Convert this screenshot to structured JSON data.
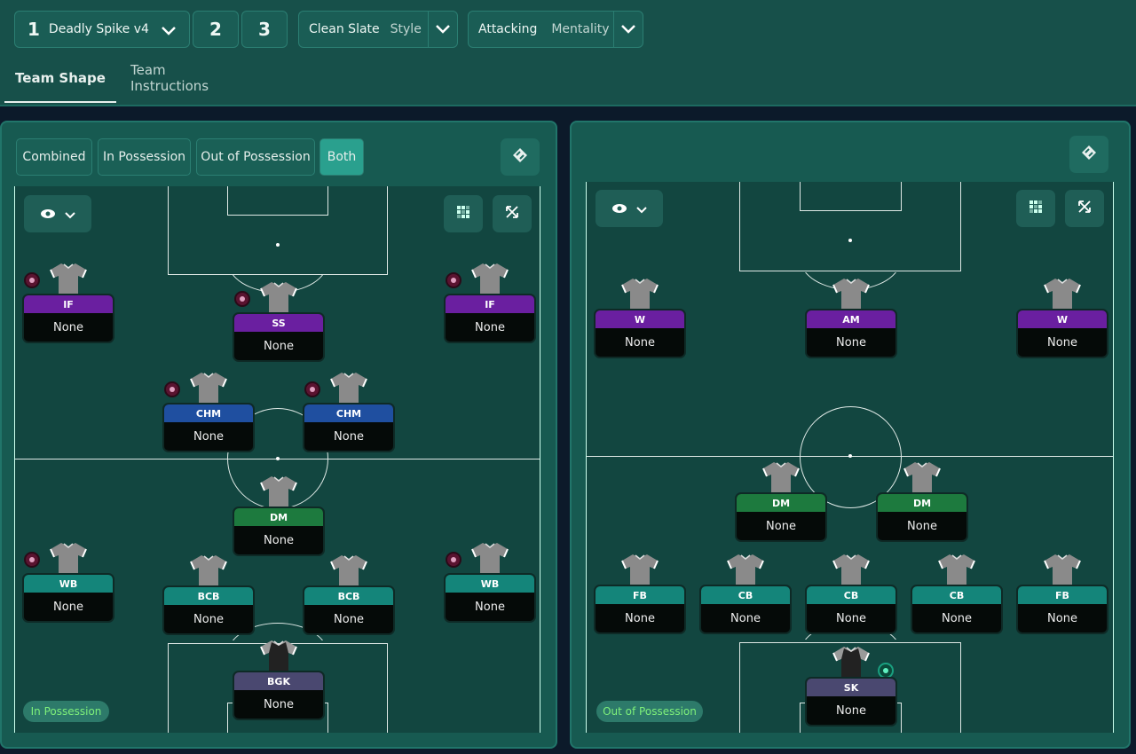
{
  "topbar": {
    "tactic_slot_active": "1",
    "tactic_name": "Deadly Spike v4",
    "tactic_slot_2": "2",
    "tactic_slot_3": "3",
    "style_value": "Clean Slate",
    "style_label": "Style",
    "mentality_value": "Attacking",
    "mentality_label": "Mentality"
  },
  "tabs": {
    "team_shape": "Team Shape",
    "team_instructions": "Team Instructions"
  },
  "left_panel": {
    "segments": [
      "Combined",
      "In Possession",
      "Out of Possession",
      "Both"
    ],
    "active_segment": "Both",
    "phase_pill": "In Possession",
    "players": [
      {
        "role": "IF",
        "name": "None",
        "color": "#6a1fa0"
      },
      {
        "role": "SS",
        "name": "None",
        "color": "#6a1fa0"
      },
      {
        "role": "IF",
        "name": "None",
        "color": "#6a1fa0"
      },
      {
        "role": "CHM",
        "name": "None",
        "color": "#1f4fa0"
      },
      {
        "role": "CHM",
        "name": "None",
        "color": "#1f4fa0"
      },
      {
        "role": "DM",
        "name": "None",
        "color": "#1d7a3e"
      },
      {
        "role": "WB",
        "name": "None",
        "color": "#14857a"
      },
      {
        "role": "BCB",
        "name": "None",
        "color": "#14857a"
      },
      {
        "role": "BCB",
        "name": "None",
        "color": "#14857a"
      },
      {
        "role": "WB",
        "name": "None",
        "color": "#14857a"
      },
      {
        "role": "BGK",
        "name": "None",
        "color": "#4a4870"
      }
    ]
  },
  "right_panel": {
    "phase_pill": "Out of Possession",
    "players": [
      {
        "role": "W",
        "name": "None",
        "color": "#6a1fa0"
      },
      {
        "role": "AM",
        "name": "None",
        "color": "#6a1fa0"
      },
      {
        "role": "W",
        "name": "None",
        "color": "#6a1fa0"
      },
      {
        "role": "DM",
        "name": "None",
        "color": "#1d7a3e"
      },
      {
        "role": "DM",
        "name": "None",
        "color": "#1d7a3e"
      },
      {
        "role": "FB",
        "name": "None",
        "color": "#14857a"
      },
      {
        "role": "CB",
        "name": "None",
        "color": "#14857a"
      },
      {
        "role": "CB",
        "name": "None",
        "color": "#14857a"
      },
      {
        "role": "CB",
        "name": "None",
        "color": "#14857a"
      },
      {
        "role": "FB",
        "name": "None",
        "color": "#14857a"
      },
      {
        "role": "SK",
        "name": "None",
        "color": "#4a4870"
      }
    ]
  }
}
